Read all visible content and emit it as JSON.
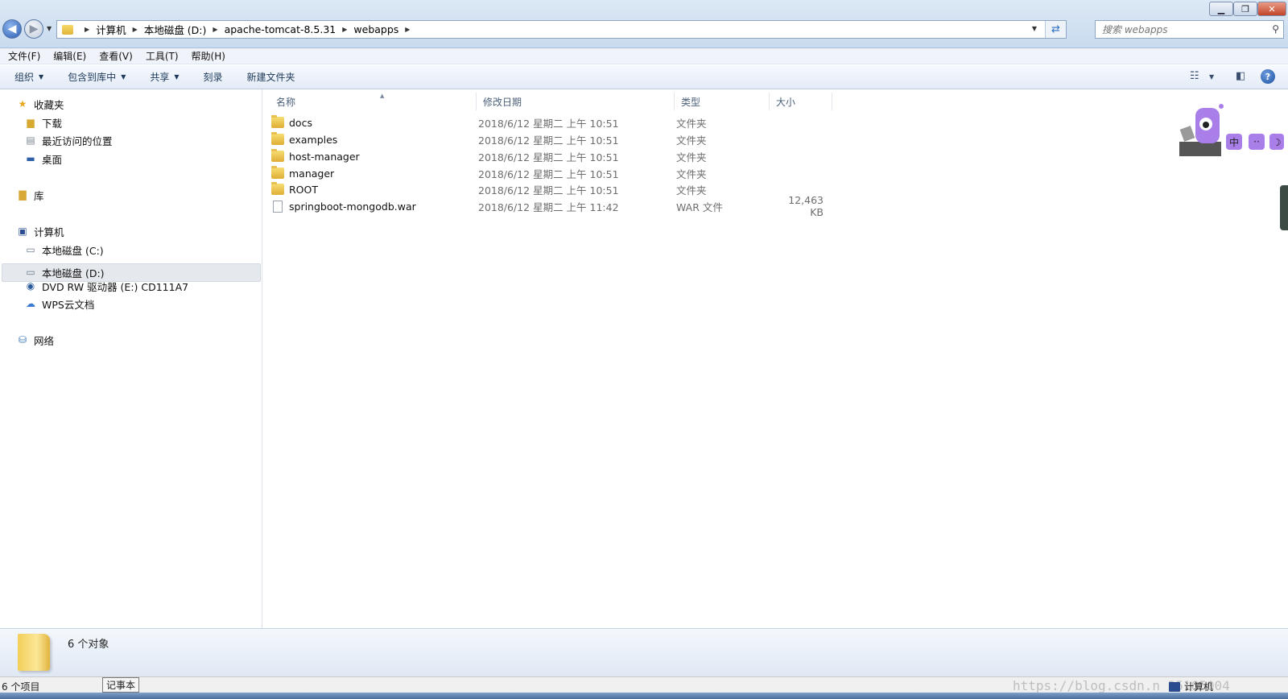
{
  "address": {
    "crumbs": [
      "计算机",
      "本地磁盘 (D:)",
      "apache-tomcat-8.5.31",
      "webapps"
    ]
  },
  "search": {
    "placeholder": "搜索 webapps"
  },
  "menu": [
    "文件(F)",
    "编辑(E)",
    "查看(V)",
    "工具(T)",
    "帮助(H)"
  ],
  "commands": {
    "organize": "组织",
    "include_library": "包含到库中",
    "share": "共享",
    "burn": "刻录",
    "new_folder": "新建文件夹"
  },
  "nav": {
    "favorites": "收藏夹",
    "downloads": "下载",
    "recent": "最近访问的位置",
    "desktop": "桌面",
    "libraries": "库",
    "computer": "计算机",
    "drive_c": "本地磁盘 (C:)",
    "drive_d": "本地磁盘 (D:)",
    "dvd": "DVD RW 驱动器 (E:) CD111A7",
    "wps": "WPS云文档",
    "network": "网络"
  },
  "columns": {
    "name": "名称",
    "date": "修改日期",
    "type": "类型",
    "size": "大小"
  },
  "files": [
    {
      "name": "docs",
      "date": "2018/6/12 星期二 上午 10:51",
      "type": "文件夹",
      "size": "",
      "kind": "folder"
    },
    {
      "name": "examples",
      "date": "2018/6/12 星期二 上午 10:51",
      "type": "文件夹",
      "size": "",
      "kind": "folder"
    },
    {
      "name": "host-manager",
      "date": "2018/6/12 星期二 上午 10:51",
      "type": "文件夹",
      "size": "",
      "kind": "folder"
    },
    {
      "name": "manager",
      "date": "2018/6/12 星期二 上午 10:51",
      "type": "文件夹",
      "size": "",
      "kind": "folder"
    },
    {
      "name": "ROOT",
      "date": "2018/6/12 星期二 上午 10:51",
      "type": "文件夹",
      "size": "",
      "kind": "folder"
    },
    {
      "name": "springboot-mongodb.war",
      "date": "2018/6/12 星期二 上午 11:42",
      "type": "WAR 文件",
      "size": "12,463 KB",
      "kind": "file"
    }
  ],
  "mascot": {
    "labels": [
      "中",
      "··",
      "☽"
    ]
  },
  "details": {
    "text": "6 个对象"
  },
  "status": {
    "count": "6 个项目",
    "tooltip": "记事本",
    "computer": "计算机",
    "watermark": "https://blog.csdn.n      35165004"
  }
}
